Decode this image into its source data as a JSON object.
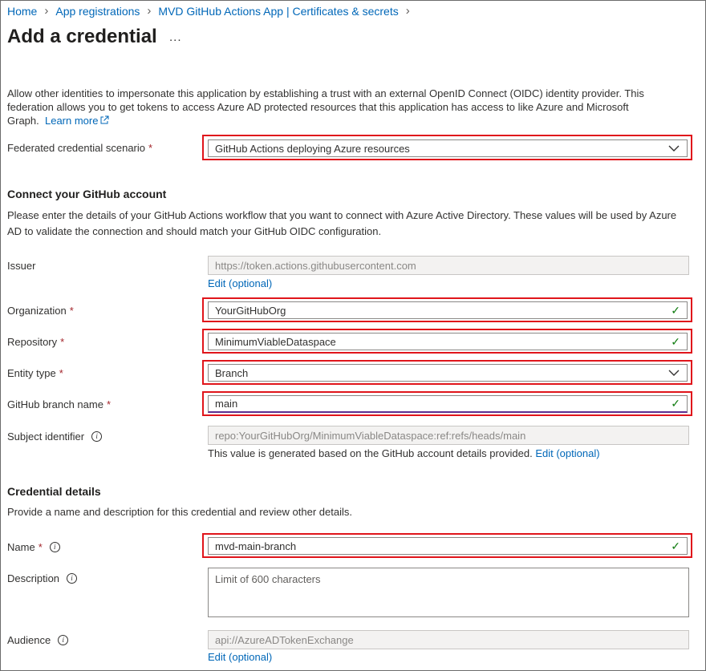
{
  "breadcrumb": [
    "Home",
    "App registrations",
    "MVD GitHub Actions App | Certificates & secrets"
  ],
  "page": {
    "title": "Add a credential",
    "more": "...",
    "intro_line1": "Allow other identities to impersonate this application by establishing a trust with an external OpenID Connect (OIDC) identity provider. This",
    "intro_line2": "federation allows you to get tokens to access Azure AD protected resources that this application has access to like Azure and Microsoft",
    "intro_line3": "Graph.",
    "learn_more": "Learn more"
  },
  "scenario": {
    "label": "Federated credential scenario",
    "value": "GitHub Actions deploying Azure resources"
  },
  "github": {
    "heading": "Connect your GitHub account",
    "desc_line1": "Please enter the details of your GitHub Actions workflow that you want to connect with Azure Active Directory. These values will be used by Azure",
    "desc_line2": "AD to validate the connection and should match your GitHub OIDC configuration.",
    "issuer_label": "Issuer",
    "issuer_value": "https://token.actions.githubusercontent.com",
    "issuer_edit": "Edit (optional)",
    "org_label": "Organization",
    "org_value": "YourGitHubOrg",
    "repo_label": "Repository",
    "repo_value": "MinimumViableDataspace",
    "entity_label": "Entity type",
    "entity_value": "Branch",
    "branch_label": "GitHub branch name",
    "branch_value": "main",
    "subject_label": "Subject identifier",
    "subject_value": "repo:YourGitHubOrg/MinimumViableDataspace:ref:refs/heads/main",
    "subject_note": "This value is generated based on the GitHub account details provided.",
    "subject_edit": "Edit (optional)"
  },
  "details": {
    "heading": "Credential details",
    "desc": "Provide a name and description for this credential and review other details.",
    "name_label": "Name",
    "name_value": "mvd-main-branch",
    "desc_label": "Description",
    "desc_placeholder": "Limit of 600 characters",
    "audience_label": "Audience",
    "audience_value": "api://AzureADTokenExchange",
    "audience_edit": "Edit (optional)"
  },
  "required_mark": "*",
  "info_glyph": "i",
  "check_glyph": "✓",
  "colors": {
    "link": "#0067b8",
    "highlight": "#e0151b",
    "valid": "#107c10",
    "required": "#a4262c"
  }
}
